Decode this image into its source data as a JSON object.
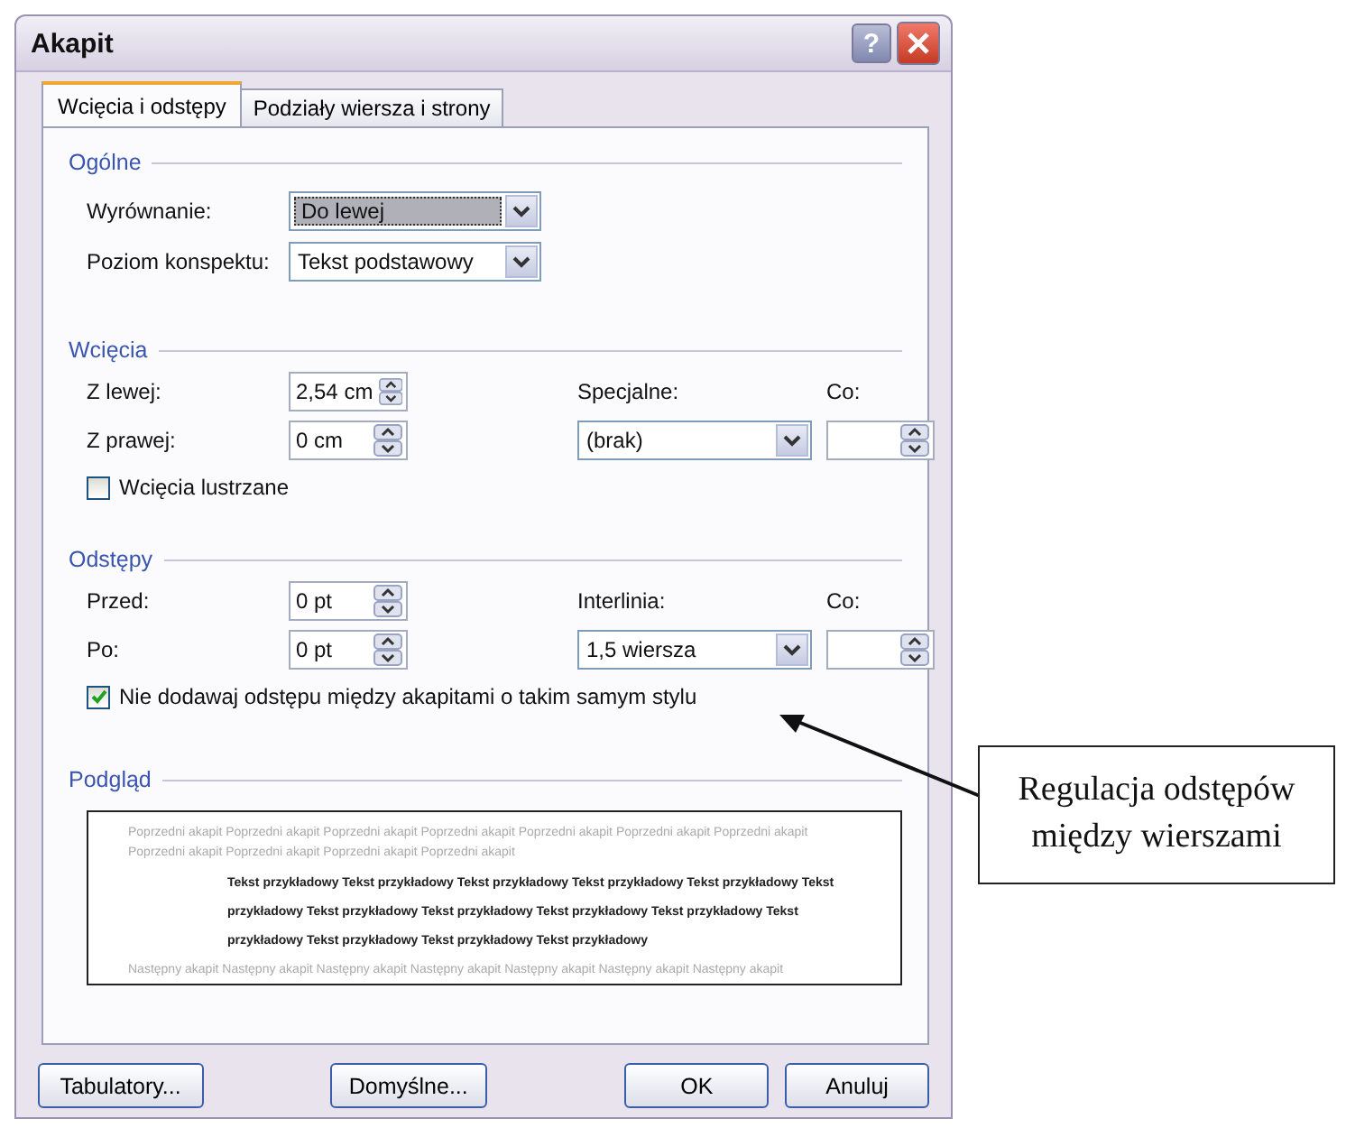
{
  "window": {
    "title": "Akapit",
    "help_button": "?"
  },
  "tabs": [
    {
      "label": "Wcięcia i odstępy",
      "selected": true
    },
    {
      "label": "Podziały wiersza i strony",
      "selected": false
    }
  ],
  "general": {
    "title": "Ogólne",
    "fields": [
      {
        "label": "Wyrównanie:",
        "value": "Do lewej",
        "highlighted": true
      },
      {
        "label": "Poziom konspektu:",
        "value": "Tekst podstawowy",
        "highlighted": false
      }
    ]
  },
  "indents": {
    "title": "Wcięcia",
    "left": {
      "label": "Z lewej:",
      "value": "2,54 cm"
    },
    "right": {
      "label": "Z prawej:",
      "value": "0 cm"
    },
    "special": {
      "label": "Specjalne:",
      "value": "(brak)"
    },
    "by": {
      "label": "Co:"
    },
    "option": {
      "label": "Wcięcia lustrzane",
      "checked": false
    }
  },
  "spacing": {
    "title": "Odstępy",
    "before": {
      "label": "Przed:",
      "value": "0 pt"
    },
    "after": {
      "label": "Po:",
      "value": "0 pt"
    },
    "line_spacing": {
      "label": "Interlinia:",
      "value": "1,5 wiersza"
    },
    "at": {
      "label": "Co:"
    },
    "option": {
      "label": "Nie dodawaj odstępu między akapitami o takim samym stylu",
      "checked": true
    }
  },
  "preview": {
    "title": "Podgląd",
    "previous": "Poprzedni akapit Poprzedni akapit Poprzedni akapit Poprzedni akapit Poprzedni akapit Poprzedni akapit Poprzedni akapit Poprzedni akapit Poprzedni akapit Poprzedni akapit Poprzedni akapit",
    "sample": "Tekst przykładowy Tekst przykładowy Tekst przykładowy Tekst przykładowy Tekst przykładowy Tekst przykładowy Tekst przykładowy Tekst przykładowy Tekst przykładowy Tekst przykładowy Tekst przykładowy Tekst przykładowy Tekst przykładowy Tekst przykładowy",
    "next": "Następny akapit Następny akapit Następny akapit Następny akapit Następny akapit Następny akapit Następny akapit"
  },
  "buttons": [
    {
      "label": "Tabulatory..."
    },
    {
      "label": "Domyślne..."
    },
    {
      "label": "OK"
    },
    {
      "label": "Anuluj"
    }
  ],
  "callout": {
    "text": "Regulacja odstępów\nmiędzy wierszami"
  }
}
